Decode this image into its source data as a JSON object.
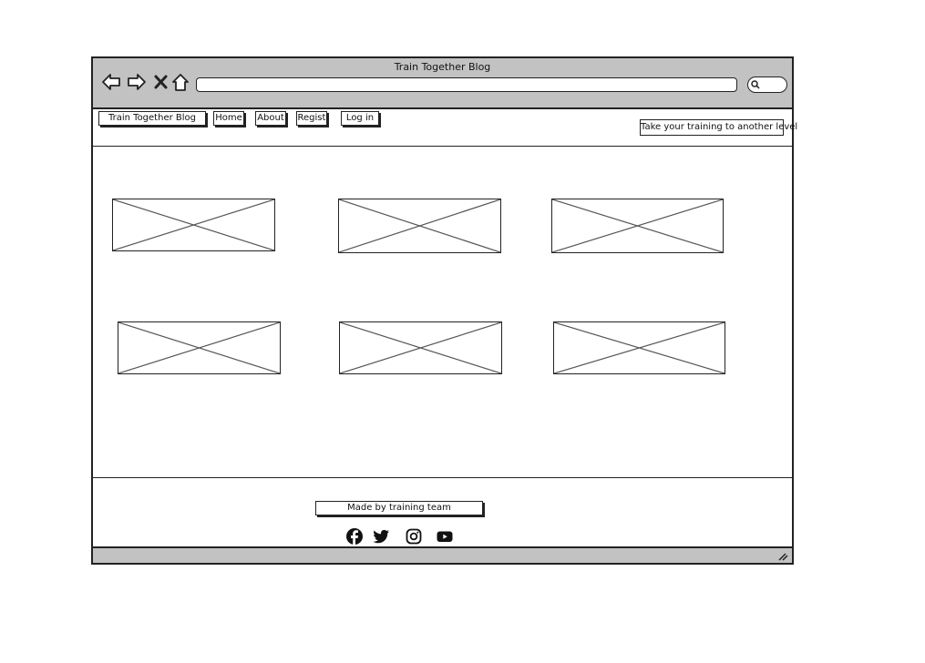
{
  "window": {
    "title": "Train Together Blog"
  },
  "toolbar": {
    "back_icon": "back-arrow-icon",
    "forward_icon": "forward-arrow-icon",
    "stop_icon": "close-icon",
    "home_icon": "home-icon",
    "address": "",
    "search_icon": "search-icon"
  },
  "nav": {
    "brand": "Train Together Blog",
    "items": [
      "Home",
      "About",
      "Regist",
      "Log in"
    ],
    "tagline": "Take your training to another level"
  },
  "gallery": {
    "rows": 2,
    "columns": 3,
    "placeholder": "image-placeholder"
  },
  "footer": {
    "credit": "Made by training team",
    "social": [
      "facebook-icon",
      "twitter-icon",
      "instagram-icon",
      "youtube-icon"
    ]
  },
  "colors": {
    "chrome": "#c2c2c2",
    "stroke": "#222222",
    "placeholder_line": "#555555"
  }
}
